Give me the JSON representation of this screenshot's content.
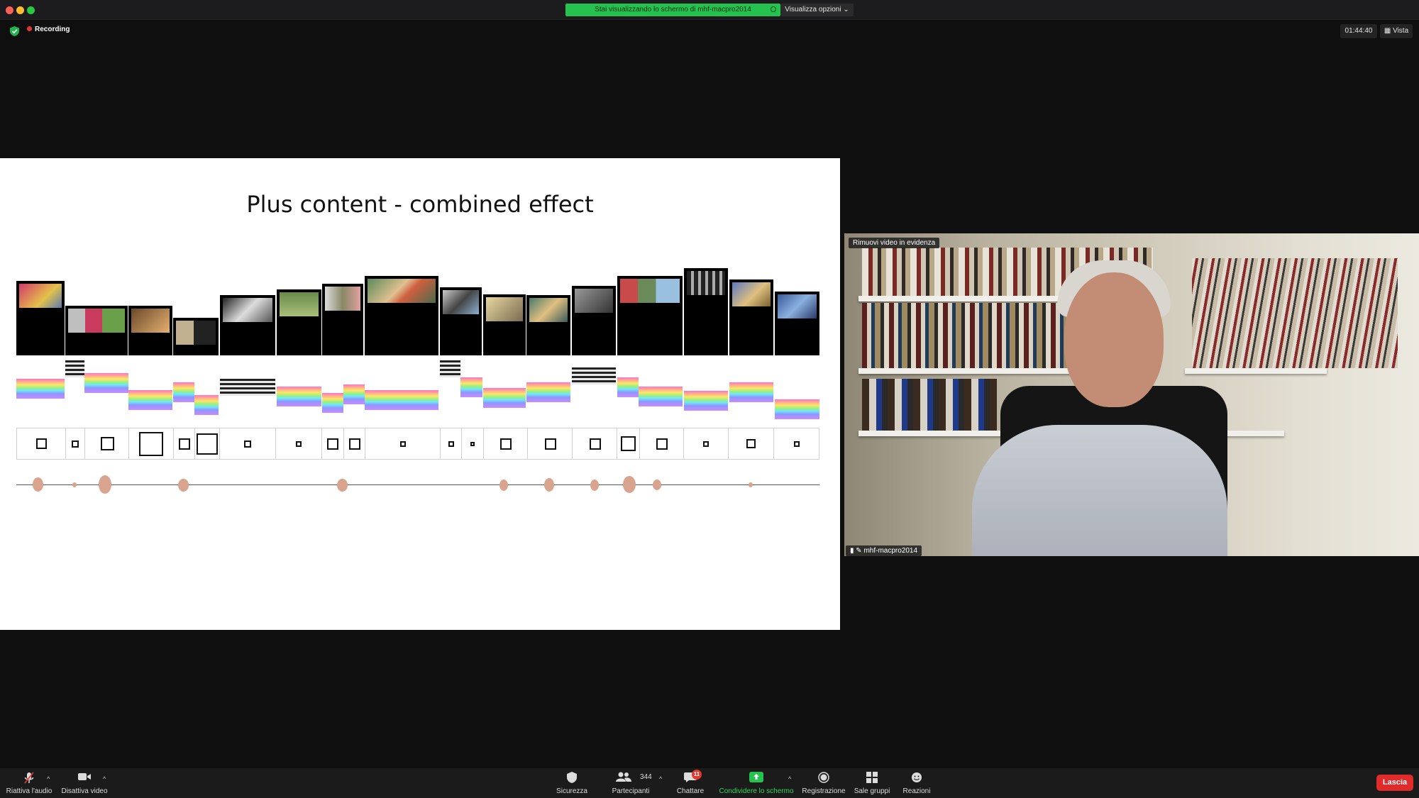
{
  "titlebar": {
    "share_banner": "Stai visualizzando lo schermo di mhf-macpro2014",
    "view_options": "Visualizza opzioni ⌄"
  },
  "status": {
    "recording_label": "Recording",
    "timer": "01:44:40",
    "view_label": "Vista"
  },
  "slide": {
    "title": "Plus content - combined effect"
  },
  "video": {
    "remove_spotlight": "Rimuovi video in evidenza",
    "participant_name": "mhf-macpro2014"
  },
  "toolbar": {
    "unmute": "Riattiva l'audio",
    "stop_video": "Disattiva video",
    "security": "Sicurezza",
    "participants": "Partecipanti",
    "participants_count": "344",
    "chat": "Chattare",
    "chat_badge": "11",
    "share": "Condividere lo schermo",
    "record": "Registrazione",
    "breakout": "Sale gruppi",
    "reactions": "Reazioni",
    "leave": "Lascia"
  },
  "colors": {
    "accent_green": "#26c24f",
    "share_label_green": "#35d35c",
    "leave_red": "#e02b2b",
    "badge_red": "#e5372f"
  }
}
